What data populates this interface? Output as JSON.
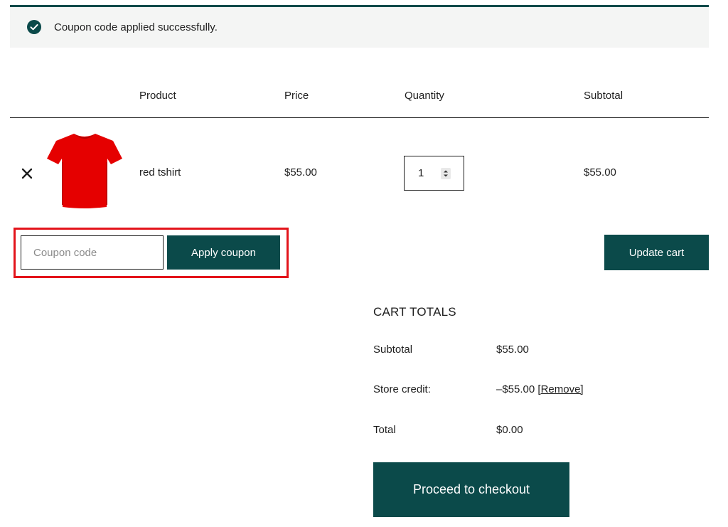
{
  "notice": {
    "icon": "check-circle-icon",
    "message": "Coupon code applied successfully."
  },
  "cart_table": {
    "headers": {
      "product": "Product",
      "price": "Price",
      "quantity": "Quantity",
      "subtotal": "Subtotal"
    },
    "items": [
      {
        "remove_icon": "close-icon",
        "thumbnail": "red-tshirt-image",
        "name": "red tshirt",
        "price": "$55.00",
        "quantity": "1",
        "subtotal": "$55.00"
      }
    ]
  },
  "coupon": {
    "placeholder": "Coupon code",
    "apply_label": "Apply coupon"
  },
  "update_cart_label": "Update cart",
  "cart_totals": {
    "title": "CART TOTALS",
    "subtotal_label": "Subtotal",
    "subtotal_value": "$55.00",
    "store_credit_label": "Store credit:",
    "store_credit_value": "–$55.00",
    "store_credit_remove": "[Remove]",
    "total_label": "Total",
    "total_value": "$0.00"
  },
  "checkout_label": "Proceed to checkout",
  "colors": {
    "primary": "#0b4a4a",
    "highlight": "#e3141b",
    "notice_bg": "#f4f5f4",
    "product": "#e50000"
  }
}
